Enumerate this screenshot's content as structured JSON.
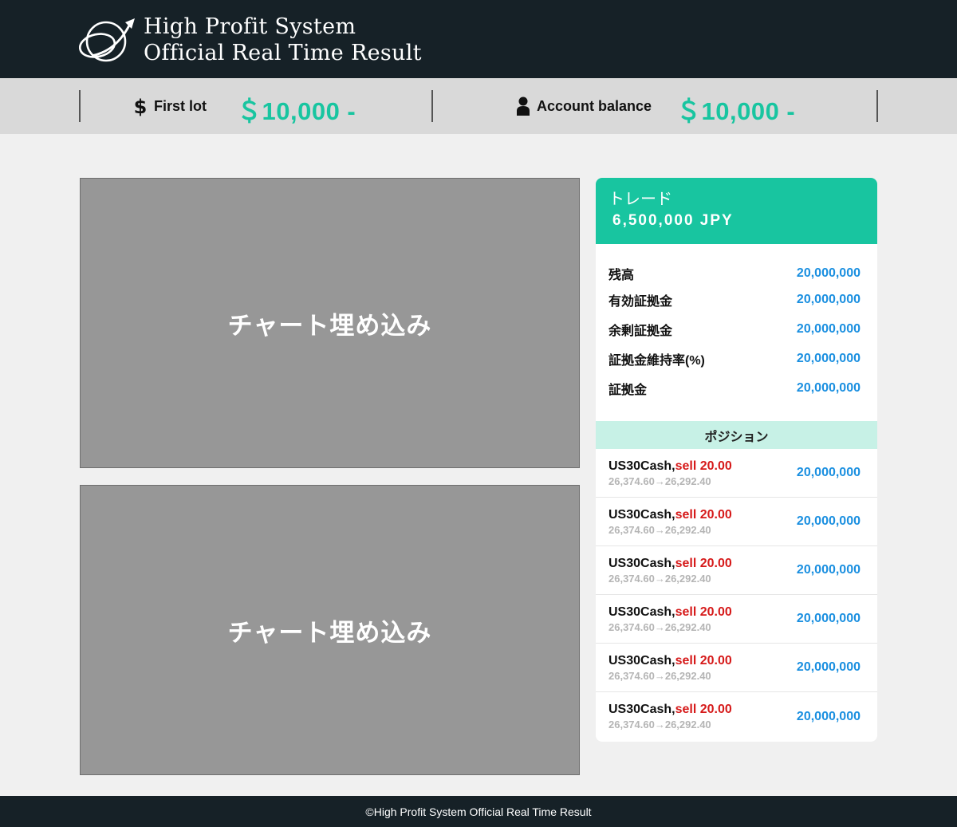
{
  "header": {
    "brand_line1": "High Profit System",
    "brand_line2": "Official Real Time Result",
    "logo_icon": "globe-arrow-logo"
  },
  "stats": {
    "first_lot": {
      "icon": "dollar-icon",
      "label": "First lot",
      "value": "＄10,000 -"
    },
    "account_balance": {
      "icon": "user-icon",
      "label": "Account balance",
      "value": "＄10,000 -"
    }
  },
  "charts": [
    {
      "label": "チャート埋め込み"
    },
    {
      "label": "チャート埋め込み"
    }
  ],
  "trade": {
    "title": "トレード",
    "amount": "6,500,000 JPY",
    "info": [
      {
        "label": "残高",
        "value": "20,000,000"
      },
      {
        "label": "有効証拠金",
        "value": "20,000,000"
      },
      {
        "label": "余剰証拠金",
        "value": "20,000,000"
      },
      {
        "label": "証拠金維持率(%)",
        "value": "20,000,000"
      },
      {
        "label": "証拠金",
        "value": "20,000,000"
      }
    ],
    "positions_heading": "ポジション",
    "positions": [
      {
        "symbol": "US30Cash,",
        "side": "sell 20.00",
        "range": "26,374.60→26,292.40",
        "value": "20,000,000"
      },
      {
        "symbol": "US30Cash,",
        "side": "sell 20.00",
        "range": "26,374.60→26,292.40",
        "value": "20,000,000"
      },
      {
        "symbol": "US30Cash,",
        "side": "sell 20.00",
        "range": "26,374.60→26,292.40",
        "value": "20,000,000"
      },
      {
        "symbol": "US30Cash,",
        "side": "sell 20.00",
        "range": "26,374.60→26,292.40",
        "value": "20,000,000"
      },
      {
        "symbol": "US30Cash,",
        "side": "sell 20.00",
        "range": "26,374.60→26,292.40",
        "value": "20,000,000"
      },
      {
        "symbol": "US30Cash,",
        "side": "sell 20.00",
        "range": "26,374.60→26,292.40",
        "value": "20,000,000"
      }
    ]
  },
  "footer": {
    "text": "©High Profit System Official Real Time Result"
  },
  "colors": {
    "header_bg": "#162127",
    "accent": "#18c5a0",
    "value_blue": "#1a8fe0",
    "sell_red": "#d61a1a",
    "position_head_bg": "#c7f1e6"
  }
}
